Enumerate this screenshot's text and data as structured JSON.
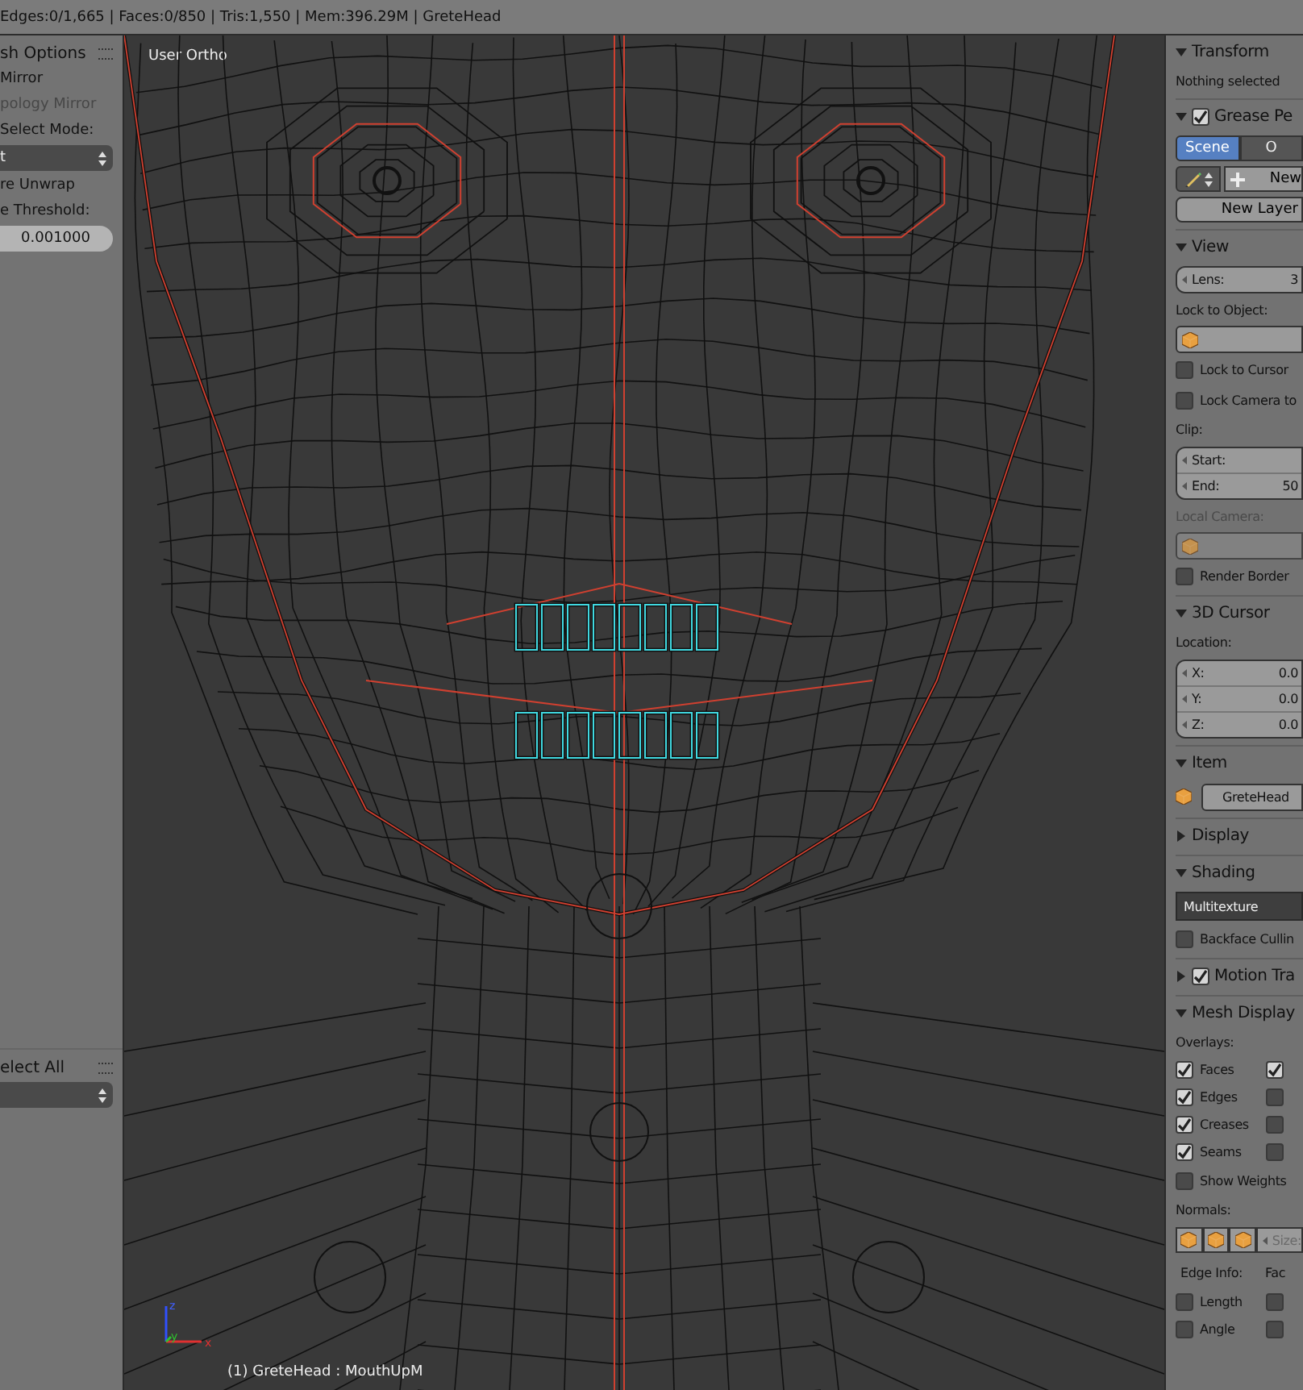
{
  "info_bar": {
    "text": "Edges:0/1,665 | Faces:0/850 | Tris:1,550 | Mem:396.29M | GreteHead"
  },
  "tool_shelf": {
    "sections": [
      {
        "title": "sh Options",
        "items": [
          {
            "kind": "text",
            "text": "Mirror",
            "disabled": false
          },
          {
            "kind": "text",
            "text": "pology Mirror",
            "disabled": true
          },
          {
            "kind": "text",
            "text": "Select Mode:",
            "disabled": false
          },
          {
            "kind": "dropdown",
            "value": "t"
          },
          {
            "kind": "text",
            "text": "re Unwrap",
            "disabled": false
          },
          {
            "kind": "text",
            "text": "e Threshold:",
            "disabled": false
          },
          {
            "kind": "number",
            "value": "0.001000"
          }
        ]
      },
      {
        "title": "elect All",
        "items": [
          {
            "kind": "dropdown",
            "value": ""
          }
        ]
      }
    ]
  },
  "viewport": {
    "view_label": "User Ortho",
    "object_label": "(1) GreteHead : MouthUpM",
    "axis_labels": [
      "z",
      "y",
      "x"
    ]
  },
  "properties": [
    {
      "kind": "header",
      "label": "Transform",
      "expanded": true
    },
    {
      "kind": "note",
      "text": "Nothing selected",
      "disabled": false
    },
    {
      "kind": "header",
      "label": "Grease Pe",
      "expanded": true,
      "checked": true
    },
    {
      "kind": "tabs",
      "tabs": [
        {
          "label": "Scene",
          "selected": true
        },
        {
          "label": "O",
          "selected": false
        }
      ]
    },
    {
      "kind": "layer_row",
      "label": "New"
    },
    {
      "kind": "button",
      "label": "New Layer"
    },
    {
      "kind": "header",
      "label": "View",
      "expanded": true
    },
    {
      "kind": "numbers",
      "fields": [
        {
          "label": "Lens:",
          "value": "3"
        }
      ]
    },
    {
      "kind": "note",
      "text": "Lock to Object:",
      "disabled": false
    },
    {
      "kind": "object_field",
      "disabled": false
    },
    {
      "kind": "checkbox",
      "label": "Lock to Cursor",
      "checked": false
    },
    {
      "kind": "checkbox",
      "label": "Lock Camera to",
      "checked": false
    },
    {
      "kind": "note",
      "text": "Clip:",
      "disabled": false
    },
    {
      "kind": "numbers",
      "fields": [
        {
          "label": "Start:"
        },
        {
          "label": "End:",
          "value": "50"
        }
      ]
    },
    {
      "kind": "note",
      "text": "Local Camera:",
      "disabled": true
    },
    {
      "kind": "object_field",
      "disabled": true
    },
    {
      "kind": "checkbox",
      "label": "Render Border",
      "checked": false
    },
    {
      "kind": "header",
      "label": "3D Cursor",
      "expanded": true
    },
    {
      "kind": "note",
      "text": "Location:",
      "disabled": false
    },
    {
      "kind": "numbers",
      "fields": [
        {
          "label": "X:",
          "value": "0.0"
        },
        {
          "label": "Y:",
          "value": "0.0"
        },
        {
          "label": "Z:",
          "value": "0.0"
        }
      ]
    },
    {
      "kind": "header",
      "label": "Item",
      "expanded": true
    },
    {
      "kind": "item_row",
      "value": "GreteHead"
    },
    {
      "kind": "header",
      "label": "Display",
      "expanded": false
    },
    {
      "kind": "header",
      "label": "Shading",
      "expanded": true
    },
    {
      "kind": "dropdown",
      "value": "Multitexture"
    },
    {
      "kind": "checkbox",
      "label": "Backface Cullin",
      "checked": false
    },
    {
      "kind": "header",
      "label": "Motion Tra",
      "expanded": false,
      "checked": true
    },
    {
      "kind": "header",
      "label": "Mesh Display",
      "expanded": true
    },
    {
      "kind": "note",
      "text": "Overlays:",
      "disabled": false
    },
    {
      "kind": "check_pair",
      "label": "Faces",
      "checked": true,
      "checked_2": true
    },
    {
      "kind": "check_pair",
      "label": "Edges",
      "checked": true,
      "checked_2": false
    },
    {
      "kind": "check_pair",
      "label": "Creases",
      "checked": true,
      "checked_2": false
    },
    {
      "kind": "check_pair",
      "label": "Seams",
      "checked": true,
      "checked_2": false
    },
    {
      "kind": "checkbox",
      "label": "Show Weights",
      "checked": false
    },
    {
      "kind": "note",
      "text": "Normals:",
      "disabled": false
    },
    {
      "kind": "normals_row",
      "size_label": "Size:"
    },
    {
      "kind": "label_pair",
      "text": "Edge Info:",
      "text_2": "Fac"
    },
    {
      "kind": "check_pair",
      "label": "Length",
      "checked": false,
      "checked_2": false
    },
    {
      "kind": "check_pair",
      "label": "Angle",
      "checked": false,
      "checked_2": false
    }
  ]
}
